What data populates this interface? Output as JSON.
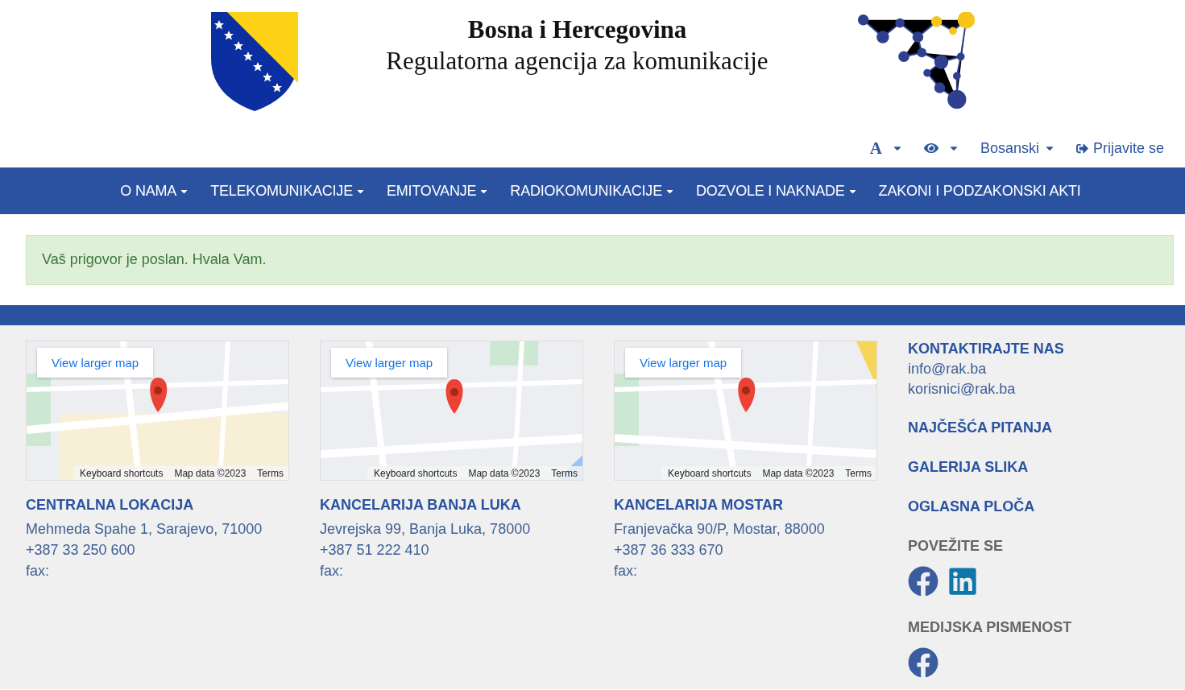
{
  "header": {
    "title": "Bosna i Hercegovina",
    "subtitle": "Regulatorna agencija za komunikacije"
  },
  "toolbar": {
    "font_size": "A",
    "language": "Bosanski",
    "login": "Prijavite se"
  },
  "nav": [
    {
      "label": "O NAMA",
      "dropdown": true
    },
    {
      "label": "TELEKOMUNIKACIJE",
      "dropdown": true
    },
    {
      "label": "EMITOVANJE",
      "dropdown": true
    },
    {
      "label": "RADIOKOMUNIKACIJE",
      "dropdown": true
    },
    {
      "label": "DOZVOLE I NAKNADE",
      "dropdown": true
    },
    {
      "label": "ZAKONI I PODZAKONSKI AKTI",
      "dropdown": false
    }
  ],
  "alert": "Vaš prigovor je poslan. Hvala Vam.",
  "offices": [
    {
      "map": {
        "kind": "picture",
        "link": "View larger map",
        "shortcuts": "Keyboard shortcuts",
        "map_data": "Map data ©2023",
        "terms": "Terms"
      },
      "title": "CENTRALNA LOKACIJA",
      "address": "Mehmeda Spahe 1, Sarajevo, 71000",
      "phone": "+387 33 250 600",
      "fax": "fax:"
    },
    {
      "map": {
        "kind": "picture",
        "link": "View larger map",
        "shortcuts": "Keyboard shortcuts",
        "map_data": "Map data ©2023",
        "terms": "Terms"
      },
      "title": "KANCELARIJA BANJA LUKA",
      "address": "Jevrejska 99, Banja Luka, 78000",
      "phone": "+387 51 222 410",
      "fax": "fax:"
    },
    {
      "map": {
        "kind": "picture",
        "link": "View larger map",
        "shortcuts": "Keyboard shortcuts",
        "map_data": "Map data ©2023",
        "terms": "Terms"
      },
      "title": "KANCELARIJA MOSTAR",
      "address": "Franjevačka 90/P, Mostar, 88000",
      "phone": "+387 36 333 670",
      "fax": "fax:"
    }
  ],
  "contact": {
    "title": "KONTAKTIRAJTE NAS",
    "emails": [
      "info@rak.ba",
      "korisnici@rak.ba"
    ]
  },
  "links": [
    "NAJČEŠĆA PITANJA",
    "GALERIJA SLIKA",
    "OGLASNA PLOČA"
  ],
  "social": [
    {
      "title": "POVEŽITE SE",
      "icons": [
        {
          "kind": "facebook"
        },
        {
          "kind": "linkedin"
        }
      ]
    },
    {
      "title": "MEDIJSKA PISMENOST",
      "icons": [
        {
          "kind": "facebook"
        }
      ]
    }
  ]
}
